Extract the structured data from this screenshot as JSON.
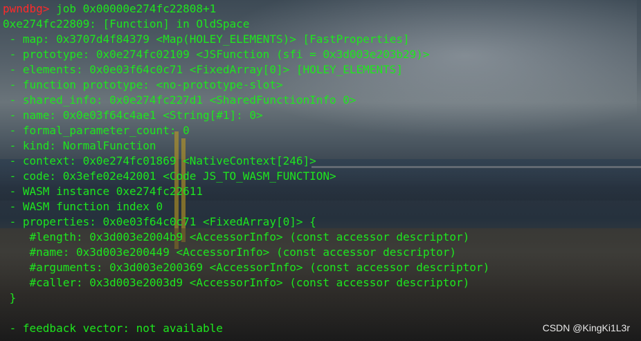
{
  "terminal": {
    "prompt": "pwndbg>",
    "command": " job 0x00000e274fc22808+1",
    "lines": [
      "0xe274fc22809: [Function] in OldSpace",
      " - map: 0x3707d4f84379 <Map(HOLEY_ELEMENTS)> [FastProperties]",
      " - prototype: 0x0e274fc02109 <JSFunction (sfi = 0x3d003e203b29)>",
      " - elements: 0x0e03f64c0c71 <FixedArray[0]> [HOLEY_ELEMENTS]",
      " - function prototype: <no-prototype-slot>",
      " - shared_info: 0x0e274fc227d1 <SharedFunctionInfo 0>",
      " - name: 0x0e03f64c4ae1 <String[#1]: 0>",
      " - formal_parameter_count: 0",
      " - kind: NormalFunction",
      " - context: 0x0e274fc01869 <NativeContext[246]>",
      " - code: 0x3efe02e42001 <Code JS_TO_WASM_FUNCTION>",
      " - WASM instance 0xe274fc22611",
      " - WASM function index 0",
      " - properties: 0x0e03f64c0c71 <FixedArray[0]> {",
      "    #length: 0x3d003e2004b9 <AccessorInfo> (const accessor descriptor)",
      "    #name: 0x3d003e200449 <AccessorInfo> (const accessor descriptor)",
      "    #arguments: 0x3d003e200369 <AccessorInfo> (const accessor descriptor)",
      "    #caller: 0x3d003e2003d9 <AccessorInfo> (const accessor descriptor)",
      " }",
      "",
      " - feedback vector: not available"
    ]
  },
  "watermark": "CSDN @KingKi1L3r",
  "colors": {
    "prompt": "#ff2a2a",
    "output": "#1ee61e",
    "watermark": "#e8e8e8"
  }
}
